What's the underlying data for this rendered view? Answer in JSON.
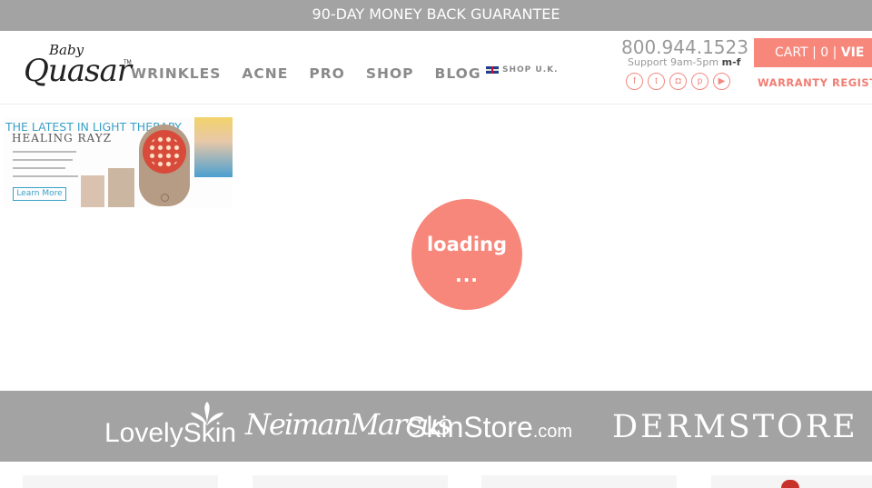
{
  "topbar": {
    "text": "90-DAY MONEY BACK GUARANTEE"
  },
  "logo": {
    "baby": "Baby",
    "quasar": "Quasar",
    "tm": "TM"
  },
  "nav": [
    {
      "label": "WRINKLES"
    },
    {
      "label": "ACNE"
    },
    {
      "label": "PRO"
    },
    {
      "label": "SHOP"
    },
    {
      "label": "BLOG"
    }
  ],
  "shop_uk": "SHOP U.K.",
  "contact": {
    "phone": "800.944.1523",
    "support_prefix": "Support 9am-5pm ",
    "support_days": "m-f"
  },
  "socials": [
    "facebook-icon",
    "twitter-icon",
    "instagram-icon",
    "pinterest-icon",
    "youtube-icon"
  ],
  "cart": {
    "label": "CART",
    "sep1": "|",
    "count": "0",
    "sep2": "|",
    "view": "VIE"
  },
  "warranty": "WARRANTY REGISTR",
  "banner": {
    "title": "THE LATEST IN LIGHT THERAPY",
    "brand": "HEALING RAYZ",
    "learn_more": "Learn More"
  },
  "loading": {
    "line1": "loading",
    "line2": "..."
  },
  "partners": {
    "lovelyskin": "LovelySkin",
    "neiman": "NeimanMarcus",
    "skinstore": "SkinStore",
    "skinstore_suffix": ".com",
    "dermstore": "DERMSTORE"
  },
  "colors": {
    "accent": "#f7877b",
    "gray_bar": "#a3a3a3",
    "nav_text": "#8a8a8a"
  }
}
